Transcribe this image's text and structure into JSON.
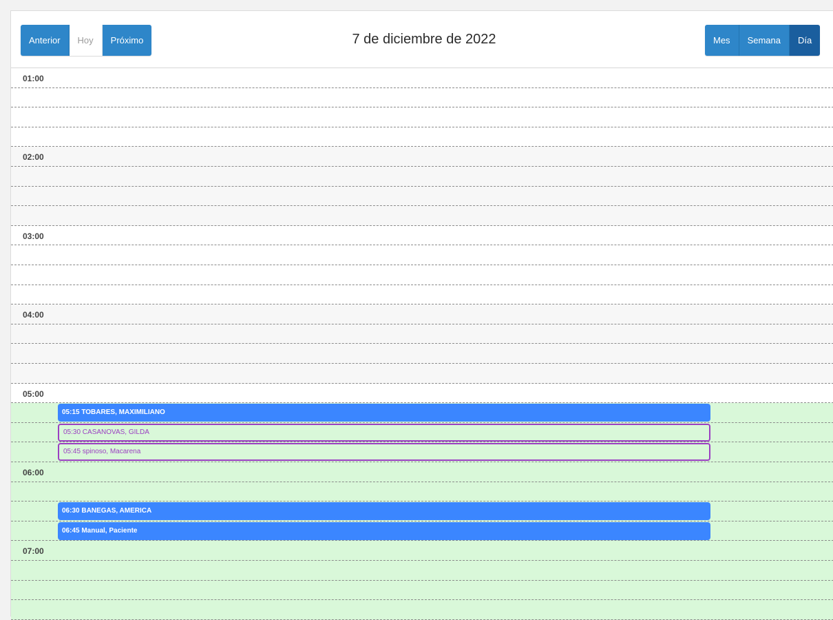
{
  "toolbar": {
    "prev_label": "Anterior",
    "today_label": "Hoy",
    "next_label": "Próximo",
    "title": "7 de diciembre de 2022",
    "views": [
      "Mes",
      "Semana",
      "Día"
    ],
    "active_view": "Día"
  },
  "hours": [
    "01:00",
    "02:00",
    "03:00",
    "04:00",
    "05:00",
    "06:00",
    "07:00"
  ],
  "events": [
    {
      "time": "05:15",
      "label": "05:15 TOBARES, MAXIMILIANO",
      "style": "filled"
    },
    {
      "time": "05:30",
      "label": "05:30 CASANOVAS, GILDA",
      "style": "outline"
    },
    {
      "time": "05:45",
      "label": "05:45 spinoso, Macarena",
      "style": "outline"
    },
    {
      "time": "06:30",
      "label": "06:30 BANEGAS, AMERICA",
      "style": "filled"
    },
    {
      "time": "06:45",
      "label": "06:45 Manual, Paciente",
      "style": "filled"
    }
  ],
  "colors": {
    "button_blue": "#2e86c9",
    "button_active": "#1a5e9e",
    "event_blue": "#3b86ff",
    "event_outline": "#9b3fc2",
    "slot_green": "#d9f8d9"
  }
}
